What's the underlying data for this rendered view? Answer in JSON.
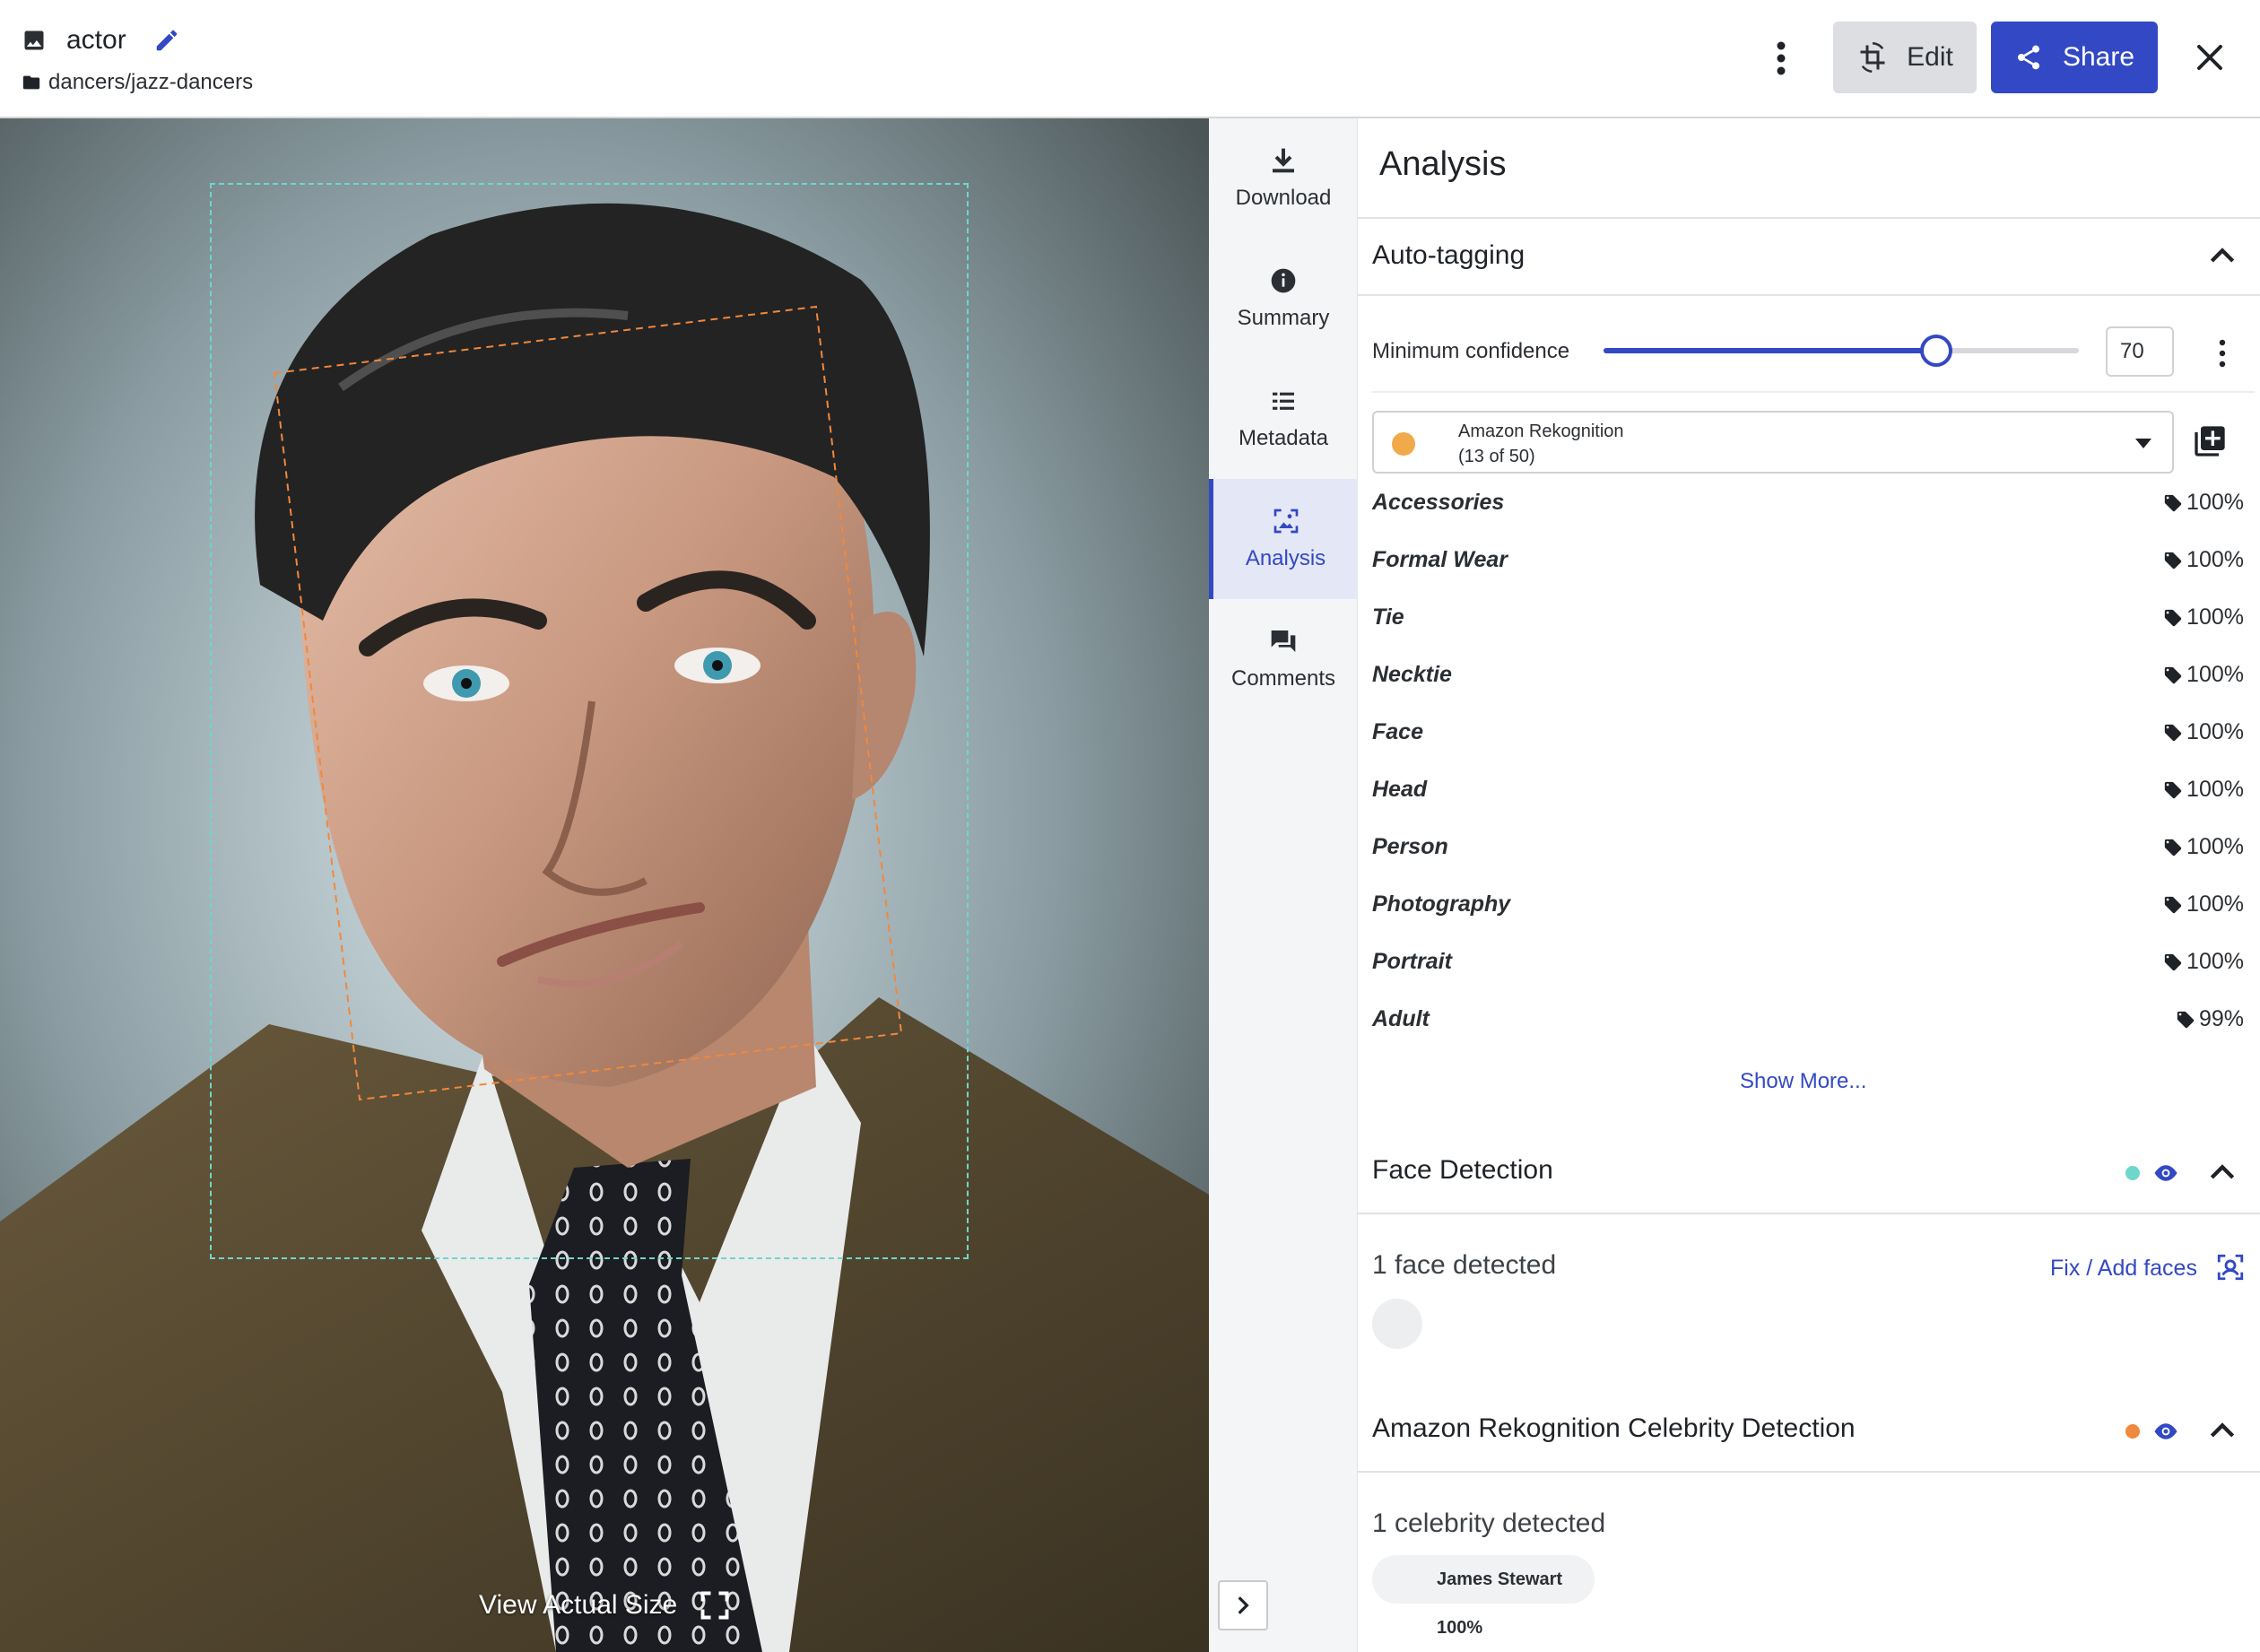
{
  "header": {
    "title": "actor",
    "path": "dancers/jazz-dancers",
    "edit_label": "Edit",
    "share_label": "Share"
  },
  "viewer": {
    "view_actual_label": "View Actual Size"
  },
  "sidenav": {
    "items": [
      {
        "label": "Download",
        "icon": "download-icon"
      },
      {
        "label": "Summary",
        "icon": "info-icon"
      },
      {
        "label": "Metadata",
        "icon": "list-icon"
      },
      {
        "label": "Analysis",
        "icon": "analysis-icon",
        "active": true
      },
      {
        "label": "Comments",
        "icon": "comments-icon"
      }
    ]
  },
  "panel": {
    "title": "Analysis",
    "auto_tagging": {
      "heading": "Auto-tagging",
      "confidence_label": "Minimum confidence",
      "confidence_value": "70",
      "confidence_fraction": 0.7,
      "provider_name": "Amazon Rekognition",
      "provider_count": "(13 of 50)",
      "provider_color": "#f2a94a",
      "tags": [
        {
          "name": "Accessories",
          "score": "100%"
        },
        {
          "name": "Formal Wear",
          "score": "100%"
        },
        {
          "name": "Tie",
          "score": "100%"
        },
        {
          "name": "Necktie",
          "score": "100%"
        },
        {
          "name": "Face",
          "score": "100%"
        },
        {
          "name": "Head",
          "score": "100%"
        },
        {
          "name": "Person",
          "score": "100%"
        },
        {
          "name": "Photography",
          "score": "100%"
        },
        {
          "name": "Portrait",
          "score": "100%"
        },
        {
          "name": "Adult",
          "score": "99%"
        }
      ],
      "show_more_label": "Show More..."
    },
    "face_detection": {
      "heading": "Face Detection",
      "status_color": "#6fd6cc",
      "count_text": "1 face detected",
      "fix_label": "Fix / Add faces"
    },
    "celebrity_detection": {
      "heading": "Amazon Rekognition Celebrity Detection",
      "status_color": "#f0883e",
      "count_text": "1 celebrity detected",
      "chip_label": "James Stewart 100%"
    }
  },
  "colors": {
    "accent": "#3348c4",
    "face_box": "#6fd6cc",
    "celebrity_box": "#f0883e"
  }
}
